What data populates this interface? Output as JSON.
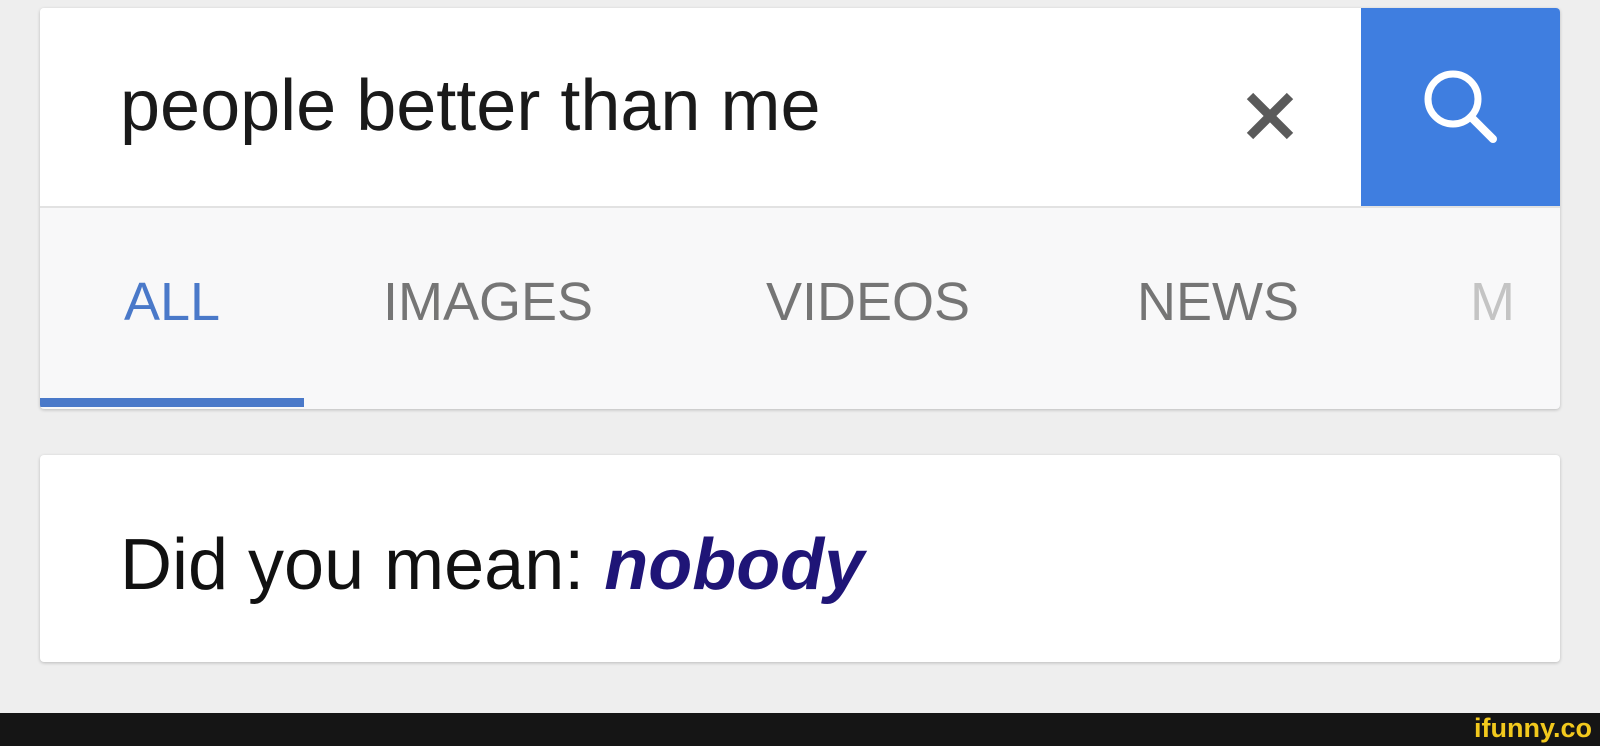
{
  "search": {
    "query": "people better than me",
    "accent_color": "#3f7ee0"
  },
  "icons": {
    "clear": "close-icon",
    "search": "search-icon"
  },
  "tabs": [
    {
      "label": "ALL",
      "active": true
    },
    {
      "label": "IMAGES",
      "active": false
    },
    {
      "label": "VIDEOS",
      "active": false
    },
    {
      "label": "NEWS",
      "active": false
    },
    {
      "label": "M",
      "active": false
    }
  ],
  "suggestion": {
    "prefix": "Did you mean: ",
    "term": "nobody"
  },
  "watermark": "ifunny.co"
}
